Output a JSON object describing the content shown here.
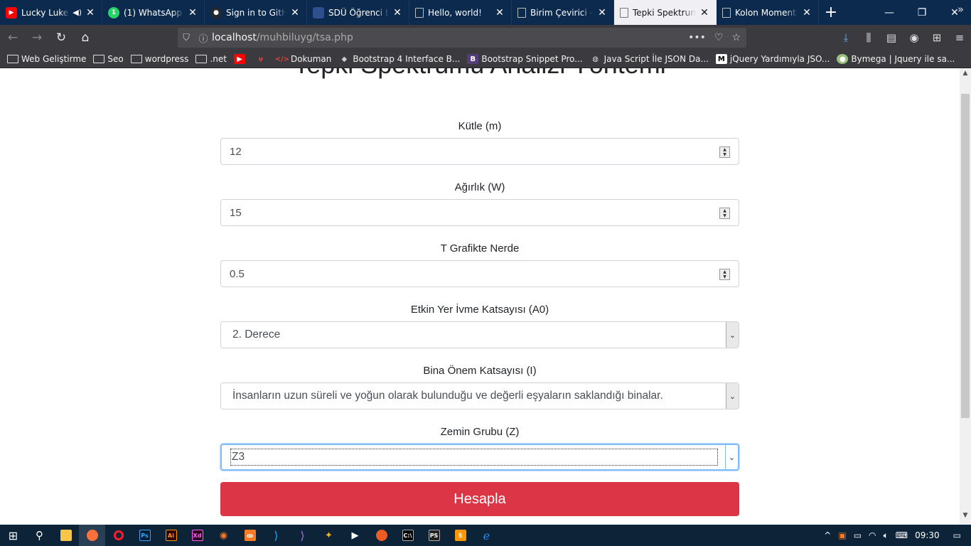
{
  "tabs": [
    {
      "title": "Lucky Luke",
      "icon": "youtube-icon",
      "color": "#ff0000",
      "glyph": "▶",
      "audio": true
    },
    {
      "title": "(1) WhatsApp",
      "icon": "whatsapp-icon",
      "color": "#25d366",
      "glyph": "1"
    },
    {
      "title": "Sign in to GitHub",
      "icon": "github-icon",
      "color": "#24292e",
      "glyph": "●"
    },
    {
      "title": "SDÜ Öğrenci Bilgi Sistemi",
      "icon": "page-icon",
      "color": "#2d4f8e",
      "glyph": ""
    },
    {
      "title": "Hello, world!",
      "icon": "page-icon",
      "color": "",
      "glyph": ""
    },
    {
      "title": "Birim Çevirici - Kuvvet",
      "icon": "page-icon",
      "color": "",
      "glyph": ""
    },
    {
      "title": "Tepki Spektrumu Analizi",
      "icon": "page-icon",
      "color": "",
      "glyph": "",
      "active": true
    },
    {
      "title": "Kolon Moment Hesabı",
      "icon": "page-icon",
      "color": "",
      "glyph": ""
    }
  ],
  "url": {
    "host": "localhost",
    "path": "/muhbiluyg/tsa.php"
  },
  "bookmarks": [
    {
      "label": "Web Geliştirme",
      "icon": "folder-icon"
    },
    {
      "label": "Seo",
      "icon": "folder-icon"
    },
    {
      "label": "wordpress",
      "icon": "folder-icon"
    },
    {
      "label": ".net",
      "icon": "folder-icon"
    },
    {
      "label": "",
      "icon": "youtube-icon"
    },
    {
      "label": "",
      "icon": "bookmark-icon"
    },
    {
      "label": "Dokuman",
      "icon": "code-icon"
    },
    {
      "label": "Bootstrap 4 Interface B...",
      "icon": "box-icon"
    },
    {
      "label": "Bootstrap Snippet Pro...",
      "icon": "bootstrap-icon"
    },
    {
      "label": "Java Script İle JSON Da...",
      "icon": "globe-icon"
    },
    {
      "label": "jQuery Yardımıyla JSO...",
      "icon": "medium-icon"
    },
    {
      "label": "Bymega | Jquery ile sa...",
      "icon": "avatar-icon"
    }
  ],
  "page": {
    "title": "Tepki Spektrumu Analizi Yöntemi",
    "fields": {
      "mass": {
        "label": "Kütle (m)",
        "value": "12"
      },
      "weight": {
        "label": "Ağırlık (W)",
        "value": "15"
      },
      "t": {
        "label": "T Grafikte Nerde",
        "value": "0.5"
      },
      "a0": {
        "label": "Etkin Yer İvme Katsayısı (A0)",
        "value": "2. Derece"
      },
      "importance": {
        "label": "Bina Önem Katsayısı (I)",
        "value": "İnsanların uzun süreli ve yoğun olarak bulunduğu ve değerli eşyaların saklandığı binalar."
      },
      "soil": {
        "label": "Zemin Grubu (Z)",
        "value": "Z3"
      }
    },
    "submit": "Hesapla"
  },
  "taskbar": {
    "clock": "09:30"
  },
  "colors": {
    "accent_button": "#dc3545",
    "focus": "#80bdff",
    "titlebar": "#0b2a4e"
  }
}
